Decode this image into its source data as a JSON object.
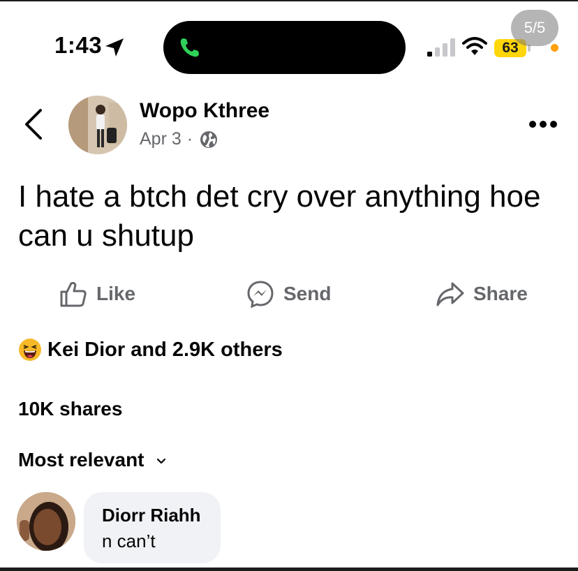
{
  "status_bar": {
    "time": "1:43",
    "battery": "63",
    "image_counter": "5/5",
    "call_color": "#30d158",
    "battery_color": "#ffd60a"
  },
  "post": {
    "author": "Wopo Kthree",
    "date": "Apr 3",
    "separator": "·",
    "text": "I hate a btch det cry over anything hoe can u shutup"
  },
  "actions": {
    "like": "Like",
    "send": "Send",
    "share": "Share"
  },
  "reactions": {
    "summary": "Kei Dior and 2.9K others",
    "icon": "laughing-emoji-icon"
  },
  "shares": "10K shares",
  "comments": {
    "sort_label": "Most relevant",
    "items": [
      {
        "author": "Diorr Riahh",
        "text": "n can’t"
      }
    ]
  },
  "colors": {
    "secondary_text": "#65676b",
    "bubble": "#f0f2f5"
  }
}
